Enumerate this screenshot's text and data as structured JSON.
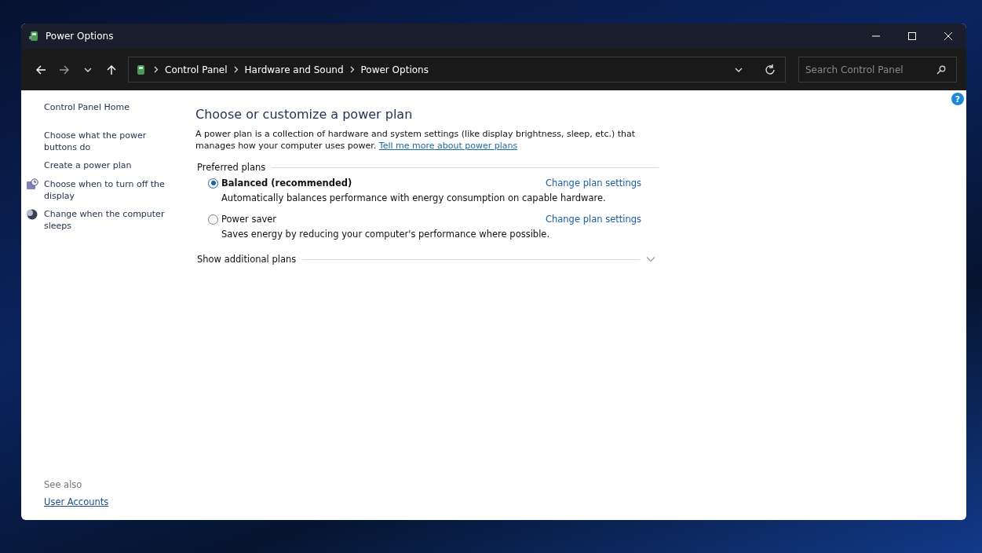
{
  "window": {
    "title": "Power Options"
  },
  "breadcrumb": [
    "Control Panel",
    "Hardware and Sound",
    "Power Options"
  ],
  "search": {
    "placeholder": "Search Control Panel"
  },
  "help": {
    "label": "?"
  },
  "sidebar": {
    "items": [
      {
        "label": "Control Panel Home",
        "kind": "plain"
      },
      {
        "label": "Choose what the power buttons do",
        "kind": "plain"
      },
      {
        "label": "Create a power plan",
        "kind": "plain"
      },
      {
        "label": "Choose when to turn off the display",
        "kind": "display"
      },
      {
        "label": "Change when the computer sleeps",
        "kind": "sleep"
      }
    ],
    "see_also_heading": "See also",
    "see_also": [
      "User Accounts"
    ]
  },
  "main": {
    "heading": "Choose or customize a power plan",
    "intro": "A power plan is a collection of hardware and system settings (like display brightness, sleep, etc.) that manages how your computer uses power.",
    "intro_link": "Tell me more about power plans",
    "group_label": "Preferred plans",
    "plans": [
      {
        "name": "Balanced (recommended)",
        "selected": true,
        "link": "Change plan settings",
        "description": "Automatically balances performance with energy consumption on capable hardware."
      },
      {
        "name": "Power saver",
        "selected": false,
        "link": "Change plan settings",
        "description": "Saves energy by reducing your computer's performance where possible."
      }
    ],
    "additional": "Show additional plans"
  }
}
